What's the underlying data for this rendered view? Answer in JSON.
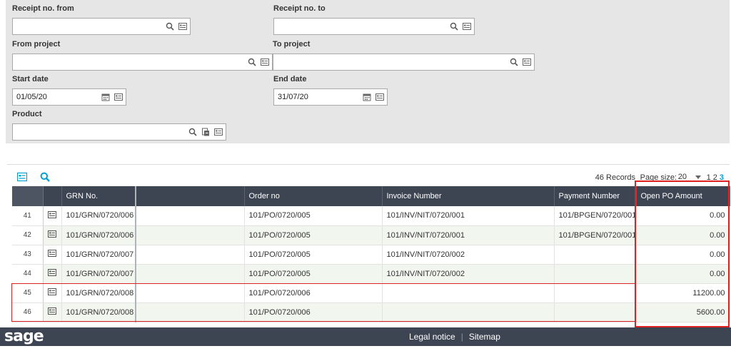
{
  "filters": {
    "receipt_from": {
      "label": "Receipt no. from",
      "value": ""
    },
    "receipt_to": {
      "label": "Receipt no. to",
      "value": ""
    },
    "from_project": {
      "label": "From project",
      "value": ""
    },
    "to_project": {
      "label": "To project",
      "value": ""
    },
    "start_date": {
      "label": "Start date",
      "value": "01/05/20"
    },
    "end_date": {
      "label": "End date",
      "value": "31/07/20"
    },
    "product": {
      "label": "Product",
      "value": ""
    }
  },
  "grid": {
    "records": "46 Records",
    "page_size_label": "Page size:",
    "page_size": "20",
    "pages": [
      "1",
      "2",
      "3"
    ],
    "current_page": "3",
    "columns": [
      "GRN No.",
      "",
      "Order no",
      "Invoice Number",
      "Payment Number",
      "Open PO Amount"
    ],
    "rows": [
      {
        "num": "41",
        "grn": "101/GRN/0720/006",
        "order": "101/PO/0720/005",
        "invoice": "101/INV/NIT/0720/001",
        "payment": "101/BPGEN/0720/001",
        "amount": "0.00"
      },
      {
        "num": "42",
        "grn": "101/GRN/0720/006",
        "order": "101/PO/0720/005",
        "invoice": "101/INV/NIT/0720/001",
        "payment": "101/BPGEN/0720/001",
        "amount": "0.00"
      },
      {
        "num": "43",
        "grn": "101/GRN/0720/007",
        "order": "101/PO/0720/005",
        "invoice": "101/INV/NIT/0720/002",
        "payment": "",
        "amount": "0.00"
      },
      {
        "num": "44",
        "grn": "101/GRN/0720/007",
        "order": "101/PO/0720/005",
        "invoice": "101/INV/NIT/0720/002",
        "payment": "",
        "amount": "0.00"
      },
      {
        "num": "45",
        "grn": "101/GRN/0720/008",
        "order": "101/PO/0720/006",
        "invoice": "",
        "payment": "",
        "amount": "11200.00"
      },
      {
        "num": "46",
        "grn": "101/GRN/0720/008",
        "order": "101/PO/0720/006",
        "invoice": "",
        "payment": "",
        "amount": "5600.00"
      }
    ]
  },
  "footer": {
    "logo": "sage",
    "links": [
      "Legal notice",
      "Sitemap"
    ]
  },
  "icons": {
    "search": "search-icon",
    "lookup": "lookup-icon",
    "calendar": "calendar-icon",
    "tunnel": "tunnel-icon",
    "detail": "detail-view-icon"
  },
  "colors": {
    "header_bg": "#3d4452",
    "accent": "#009fd4",
    "highlight": "#dd2222",
    "row_alt": "#f1f6ef"
  }
}
